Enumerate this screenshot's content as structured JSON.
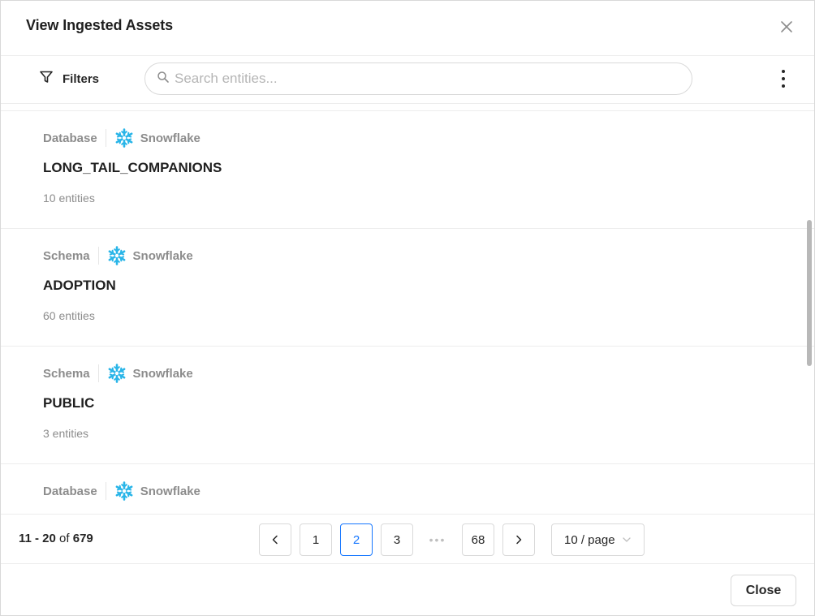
{
  "modal": {
    "title": "View Ingested Assets",
    "close_label": "Close"
  },
  "toolbar": {
    "filters_label": "Filters",
    "search_placeholder": "Search entities..."
  },
  "entities": [
    {
      "type": "Database",
      "platform": "Snowflake",
      "name": "LONG_TAIL_COMPANIONS",
      "count": "10 entities"
    },
    {
      "type": "Schema",
      "platform": "Snowflake",
      "name": "ADOPTION",
      "count": "60 entities"
    },
    {
      "type": "Schema",
      "platform": "Snowflake",
      "name": "PUBLIC",
      "count": "3 entities"
    },
    {
      "type": "Database",
      "platform": "Snowflake",
      "name": "",
      "count": ""
    }
  ],
  "pagination": {
    "range": "11 - 20",
    "of_label": "of",
    "total": "679",
    "pages": [
      "1",
      "2",
      "3",
      "68"
    ],
    "active_page": "2",
    "ellipsis": "•••",
    "page_size": "10 / page"
  },
  "colors": {
    "accent": "#1677ff",
    "snowflake": "#29b5e8",
    "muted_text": "#8c8c8c"
  },
  "icons": {
    "close": "close-icon",
    "filter": "filter-icon",
    "search": "search-icon",
    "more": "more-vertical-icon",
    "platform": "snowflake-icon",
    "prev": "chevron-left-icon",
    "next": "chevron-right-icon",
    "dropdown": "chevron-down-icon"
  }
}
